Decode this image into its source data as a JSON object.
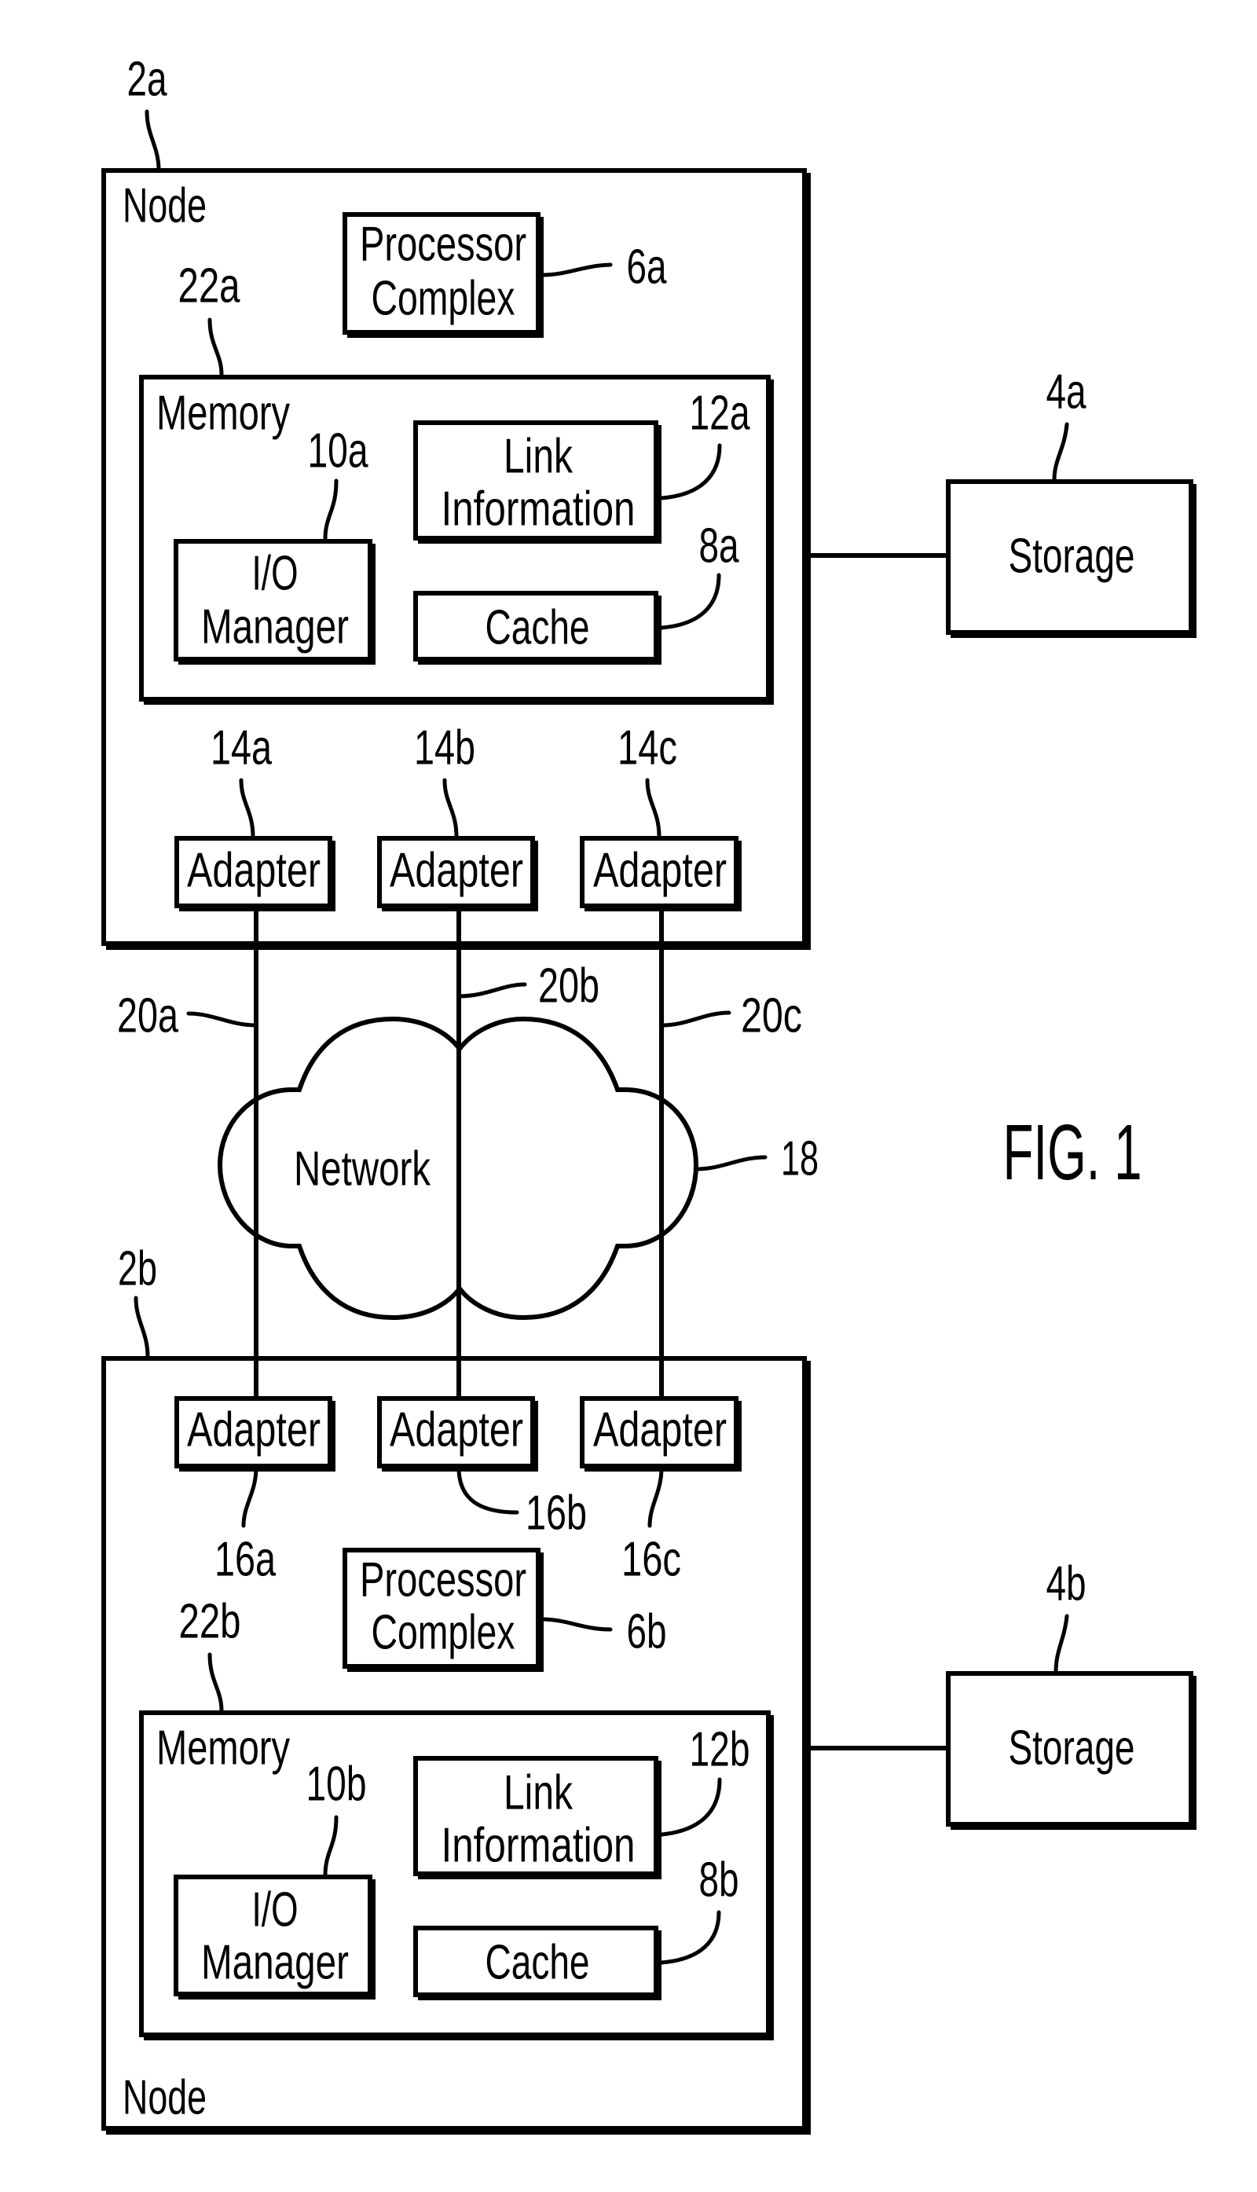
{
  "figure": {
    "title": "FIG. 1"
  },
  "node_a": {
    "ref": "2a",
    "label": "Node",
    "processor": {
      "ref": "6a",
      "line1": "Processor",
      "line2": "Complex"
    },
    "memory": {
      "ref": "22a",
      "label": "Memory",
      "io_manager": {
        "ref": "10a",
        "line1": "I/O",
        "line2": "Manager"
      },
      "link_info": {
        "ref": "12a",
        "line1": "Link",
        "line2": "Information"
      },
      "cache": {
        "ref": "8a",
        "label": "Cache"
      }
    },
    "adapters": [
      {
        "ref": "14a",
        "label": "Adapter"
      },
      {
        "ref": "14b",
        "label": "Adapter"
      },
      {
        "ref": "14c",
        "label": "Adapter"
      }
    ],
    "storage": {
      "ref": "4a",
      "label": "Storage"
    }
  },
  "network": {
    "ref": "18",
    "label": "Network",
    "paths": [
      {
        "ref": "20a"
      },
      {
        "ref": "20b"
      },
      {
        "ref": "20c"
      }
    ]
  },
  "node_b": {
    "ref": "2b",
    "label": "Node",
    "processor": {
      "ref": "6b",
      "line1": "Processor",
      "line2": "Complex"
    },
    "memory": {
      "ref": "22b",
      "label": "Memory",
      "io_manager": {
        "ref": "10b",
        "line1": "I/O",
        "line2": "Manager"
      },
      "link_info": {
        "ref": "12b",
        "line1": "Link",
        "line2": "Information"
      },
      "cache": {
        "ref": "8b",
        "label": "Cache"
      }
    },
    "adapters": [
      {
        "ref": "16a",
        "label": "Adapter"
      },
      {
        "ref": "16b",
        "label": "Adapter"
      },
      {
        "ref": "16c",
        "label": "Adapter"
      }
    ],
    "storage": {
      "ref": "4b",
      "label": "Storage"
    }
  }
}
